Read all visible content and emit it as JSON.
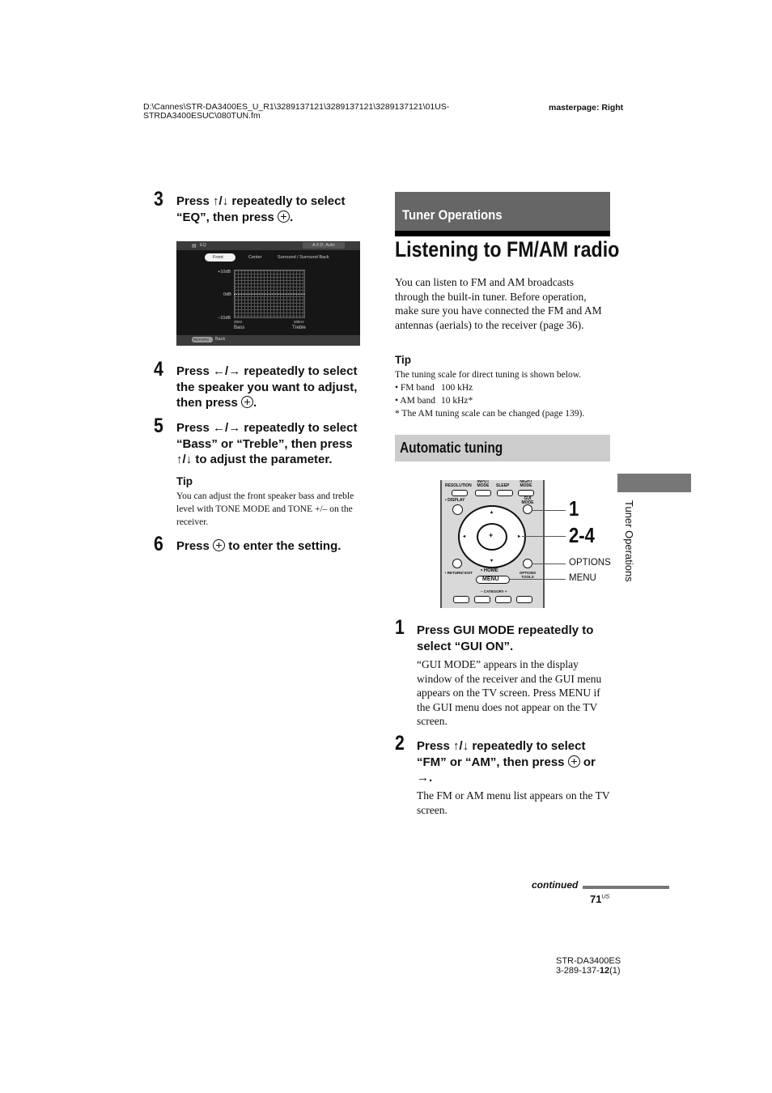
{
  "header": {
    "path_line1": "D:\\Cannes\\STR-DA3400ES_U_R1\\3289137121\\3289137121\\3289137121\\01US-",
    "path_line2": "STRDA3400ESUC\\080TUN.fm",
    "masterpage": "masterpage: Right"
  },
  "left_column": {
    "step3": {
      "num": "3",
      "text_a": "Press ↑/↓ repeatedly to select",
      "text_b": "“EQ”, then press",
      "text_end": "."
    },
    "eq_screen": {
      "title": "EQ",
      "afd": "A.F.D. Auto",
      "tabs": [
        "Front",
        "Center",
        "Surround / Surround Back"
      ],
      "y_labels": [
        "+10dB",
        "0dB",
        "−10dB"
      ],
      "x_labels": [
        "20Hz",
        "20kHz"
      ],
      "bands": [
        "Bass",
        "Treble"
      ],
      "return_btn": "RETURN",
      "back_label": "Back"
    },
    "step4": {
      "num": "4",
      "line1": "Press ←/→ repeatedly to select",
      "line2": "the speaker you want to adjust,",
      "line3": "then press",
      "line3_end": "."
    },
    "step5": {
      "num": "5",
      "line1": "Press ←/→ repeatedly to select",
      "line2": "“Bass” or “Treble”, then press",
      "line3": "↑/↓ to adjust the parameter."
    },
    "tip": {
      "heading": "Tip",
      "text": "You can adjust the front speaker bass and treble level with TONE MODE and TONE +/– on the receiver."
    },
    "step6": {
      "num": "6",
      "text_a": "Press",
      "text_b": "to enter the setting."
    }
  },
  "right_column": {
    "section": "Tuner Operations",
    "title": "Listening to FM/AM radio",
    "intro": "You can listen to FM and AM broadcasts through the built-in tuner. Before operation, make sure you have connected the FM and AM antennas (aerials) to the receiver (page 36).",
    "tip": {
      "heading": "Tip",
      "line1": "The tuning scale for direct tuning is shown below.",
      "fm_band": "• FM band",
      "fm_value": "100 kHz",
      "am_band": "• AM band",
      "am_value": "10 kHz*",
      "footnote": "* The AM tuning scale can be changed (page 139)."
    },
    "subsection": "Automatic tuning",
    "remote": {
      "buttons_top": [
        "RESOLUTION",
        "INPUT MODE",
        "SLEEP",
        "NIGHT MODE"
      ],
      "display": "• DISPLAY",
      "gui_mode": "GUI MODE",
      "return_exit": "• RETURN/ EXIT",
      "home": "• HOME",
      "menu": "MENU",
      "options_tools": "OPTIONS TOOLS",
      "category": "–  CATEGORY  +",
      "callouts": [
        "1",
        "2-4",
        "OPTIONS",
        "MENU"
      ]
    },
    "step1": {
      "num": "1",
      "title": "Press GUI MODE repeatedly to select “GUI ON”.",
      "body": "“GUI MODE” appears in the display window of the receiver and the GUI menu appears on the TV screen. Press MENU if the GUI menu does not appear on the TV screen."
    },
    "step2": {
      "num": "2",
      "line1": "Press ↑/↓ repeatedly to select",
      "line2a": "“FM” or “AM”, then press",
      "line2b": "or",
      "line3": "→.",
      "body": "The FM or AM menu list appears on the TV screen."
    }
  },
  "side_tab_label": "Tuner Operations",
  "footer": {
    "continued": "continued",
    "page": "71",
    "page_sup": "US",
    "model": "STR-DA3400ES",
    "code_a": "3-289-137-",
    "code_b": "12",
    "code_c": "(1)"
  }
}
